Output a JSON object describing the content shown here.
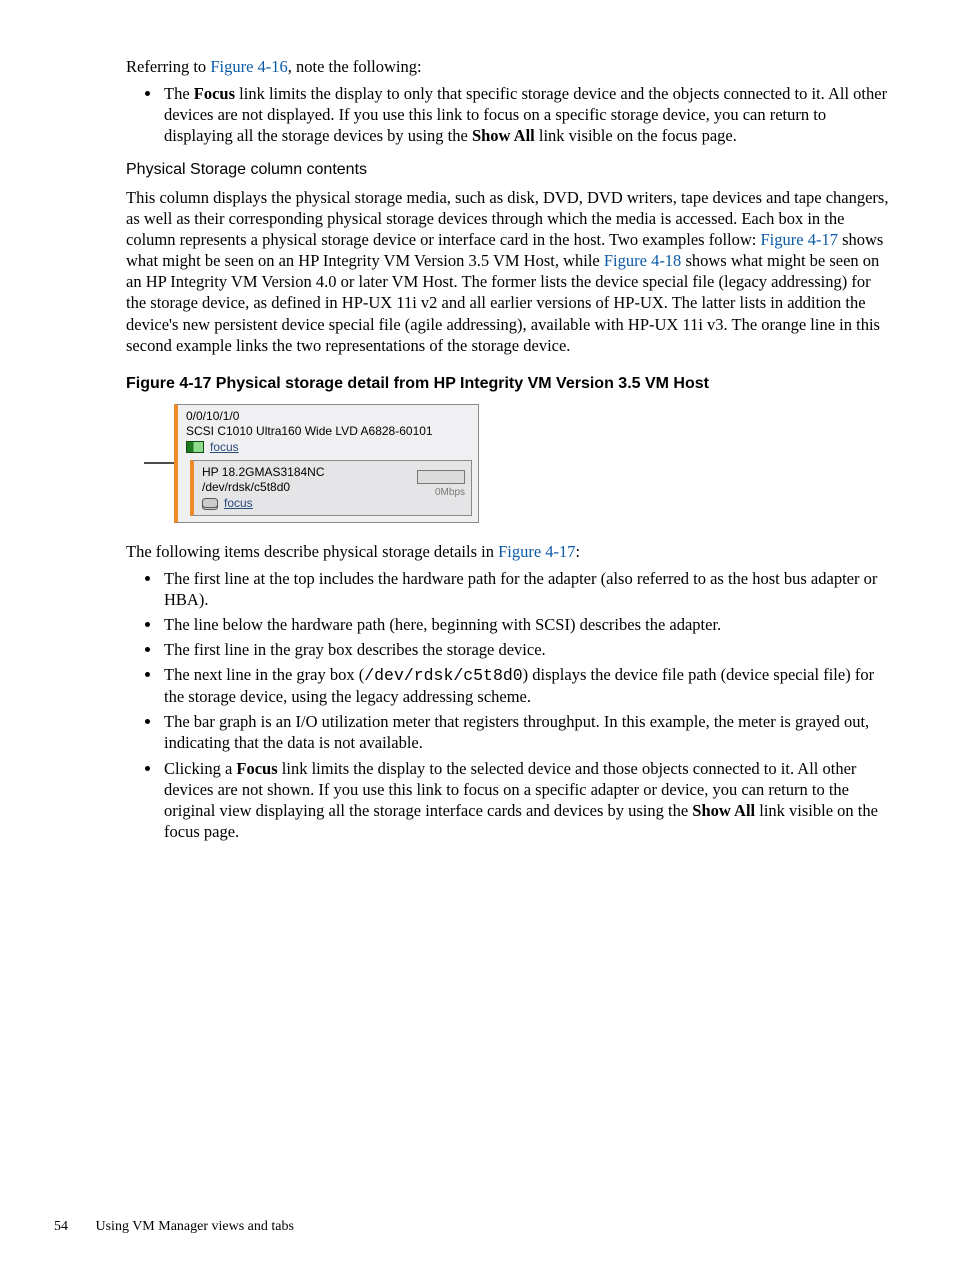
{
  "para1_1": "Referring to ",
  "para1_link": "Figure 4-16",
  "para1_2": ", note the following:",
  "bullets1": {
    "item1_pre": "The ",
    "item1_bold1": "Focus",
    "item1_mid": " link limits the display to only that specific storage device and the objects connected to it. All other devices are not displayed. If you use this link to focus on a specific storage device, you can return to displaying all the storage devices by using the ",
    "item1_bold2": "Show All",
    "item1_post": " link visible on the focus page."
  },
  "subhead1": "Physical Storage column contents",
  "para2_1": "This column displays the physical storage media, such as disk, DVD, DVD writers, tape devices and tape changers, as well as their corresponding physical storage devices through which the media is accessed. Each box in the column represents a physical storage device or interface card in the host. Two examples follow: ",
  "para2_link1": "Figure 4-17",
  "para2_2": " shows what might be seen on an HP Integrity VM Version 3.5 VM Host, while ",
  "para2_link2": "Figure 4-18",
  "para2_3": " shows what might be seen on an HP Integrity VM Version 4.0 or later VM Host. The former lists the device special file (legacy addressing) for the storage device, as defined in HP-UX 11i v2 and all earlier versions of HP-UX. The latter lists in addition the device's new persistent device special file (agile addressing), available with HP-UX 11i v3. The orange line in this second example links the two representations of the storage device.",
  "figcap": "Figure 4-17 Physical storage detail from HP Integrity VM Version 3.5 VM Host",
  "fig": {
    "adapter_path": "0/0/10/1/0",
    "adapter_desc": "SCSI C1010 Ultra160 Wide LVD A6828-60101",
    "adapter_focus": "focus",
    "device_name": "HP 18.2GMAS3184NC",
    "device_path": "/dev/rdsk/c5t8d0",
    "device_focus": "focus",
    "meter_label": "0Mbps"
  },
  "para3_1": "The following items describe physical storage details in ",
  "para3_link": "Figure 4-17",
  "para3_2": ":",
  "bullets2": {
    "i1": "The first line at the top includes the hardware path for the adapter (also referred to as the host bus adapter or HBA).",
    "i2": "The line below the hardware path (here, beginning with SCSI) describes the adapter.",
    "i3": "The first line in the gray box describes the storage device.",
    "i4_pre": "The next line in the gray box (",
    "i4_code": "/dev/rdsk/c5t8d0",
    "i4_post": ") displays the device file path (device special file) for the storage device, using the legacy addressing scheme.",
    "i5": "The bar graph is an I/O utilization meter that registers throughput. In this example, the meter is grayed out, indicating that the data is not available.",
    "i6_pre": "Clicking a ",
    "i6_bold1": "Focus",
    "i6_mid": " link limits the display to the selected device and those objects connected to it. All other devices are not shown. If you use this link to focus on a specific adapter or device, you can return to the original view displaying all the storage interface cards and devices by using the ",
    "i6_bold2": "Show All",
    "i6_post": " link visible on the focus page."
  },
  "footer_page": "54",
  "footer_text": "Using VM Manager views and tabs"
}
